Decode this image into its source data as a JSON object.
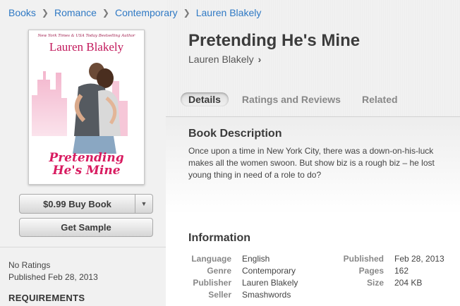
{
  "breadcrumb": [
    "Books",
    "Romance",
    "Contemporary",
    "Lauren Blakely"
  ],
  "cover": {
    "tagline": "New York Times & USA Today Bestselling Author",
    "author": "Lauren Blakely",
    "title_line1": "Pretending",
    "title_line2": "He's Mine"
  },
  "purchase": {
    "buy_label": "$0.99 Buy Book",
    "sample_label": "Get Sample"
  },
  "ratings": {
    "status": "No Ratings",
    "published": "Published Feb 28, 2013"
  },
  "requirements_heading": "REQUIREMENTS",
  "book": {
    "title": "Pretending He's Mine",
    "author": "Lauren Blakely"
  },
  "tabs": [
    {
      "label": "Details",
      "active": true
    },
    {
      "label": "Ratings and Reviews",
      "active": false
    },
    {
      "label": "Related",
      "active": false
    }
  ],
  "description": {
    "heading": "Book Description",
    "lines": [
      "Once upon a time in New York City, there was a down-on-his-luck",
      "makes all the women swoon. But show biz is a rough biz – he lost",
      "young thing in need of a role to do?"
    ]
  },
  "information": {
    "heading": "Information",
    "left": [
      {
        "key": "Language",
        "value": "English"
      },
      {
        "key": "Genre",
        "value": "Contemporary"
      },
      {
        "key": "Publisher",
        "value": "Lauren Blakely"
      },
      {
        "key": "Seller",
        "value": "Smashwords"
      }
    ],
    "right": [
      {
        "key": "Published",
        "value": "Feb 28, 2013"
      },
      {
        "key": "Pages",
        "value": "162"
      },
      {
        "key": "Size",
        "value": "204 KB"
      }
    ]
  },
  "colors": {
    "link": "#2f79c4",
    "cover_accent": "#d81b60"
  }
}
